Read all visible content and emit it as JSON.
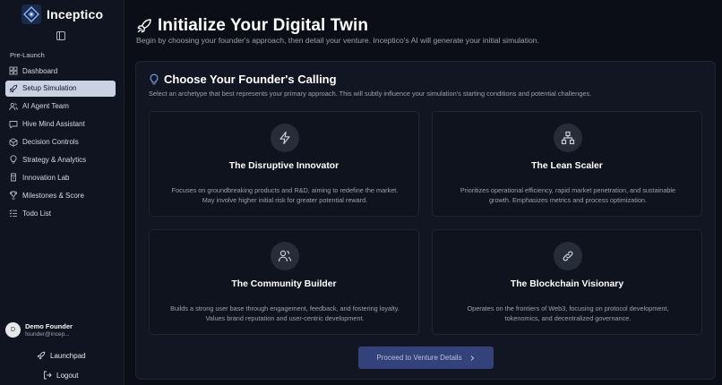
{
  "brand": {
    "name": "Inceptico"
  },
  "sidebar": {
    "section_label": "Pre-Launch",
    "items": [
      {
        "label": "Dashboard",
        "icon": "dashboard-icon"
      },
      {
        "label": "Setup Simulation",
        "icon": "rocket-icon",
        "active": true
      },
      {
        "label": "AI Agent Team",
        "icon": "users-icon"
      },
      {
        "label": "Hive Mind Assistant",
        "icon": "chat-icon"
      },
      {
        "label": "Decision Controls",
        "icon": "package-icon"
      },
      {
        "label": "Strategy & Analytics",
        "icon": "lightbulb-icon"
      },
      {
        "label": "Innovation Lab",
        "icon": "flask-icon"
      },
      {
        "label": "Milestones & Score",
        "icon": "trophy-icon"
      },
      {
        "label": "Todo List",
        "icon": "list-icon"
      }
    ],
    "user": {
      "initial": "D",
      "name": "Demo Founder",
      "email": "founder@incep..."
    },
    "launchpad_label": "Launchpad",
    "logout_label": "Logout"
  },
  "header": {
    "title": "Initialize Your Digital Twin",
    "subtitle": "Begin by choosing your founder's approach, then detail your venture. Inceptico's AI will generate your initial simulation."
  },
  "panel": {
    "title": "Choose Your Founder's Calling",
    "description": "Select an archetype that best represents your primary approach. This will subtly influence your simulation's starting conditions and potential challenges.",
    "cards": [
      {
        "title": "The Disruptive Innovator",
        "description": "Focuses on groundbreaking products and R&D, aiming to redefine the market. May involve higher initial risk for greater potential reward.",
        "icon": "lightning-icon"
      },
      {
        "title": "The Lean Scaler",
        "description": "Prioritizes operational efficiency, rapid market penetration, and sustainable growth. Emphasizes metrics and process optimization.",
        "icon": "network-icon"
      },
      {
        "title": "The Community Builder",
        "description": "Builds a strong user base through engagement, feedback, and fostering loyalty. Values brand reputation and user-centric development.",
        "icon": "users-icon"
      },
      {
        "title": "The Blockchain Visionary",
        "description": "Operates on the frontiers of Web3, focusing on protocol development, tokenomics, and decentralized governance.",
        "icon": "link-icon"
      }
    ],
    "proceed_label": "Proceed to Venture Details"
  },
  "colors": {
    "background": "#0b0e17",
    "sidebar": "#101420",
    "active_item": "#c9d1e3",
    "button": "#33427a"
  }
}
